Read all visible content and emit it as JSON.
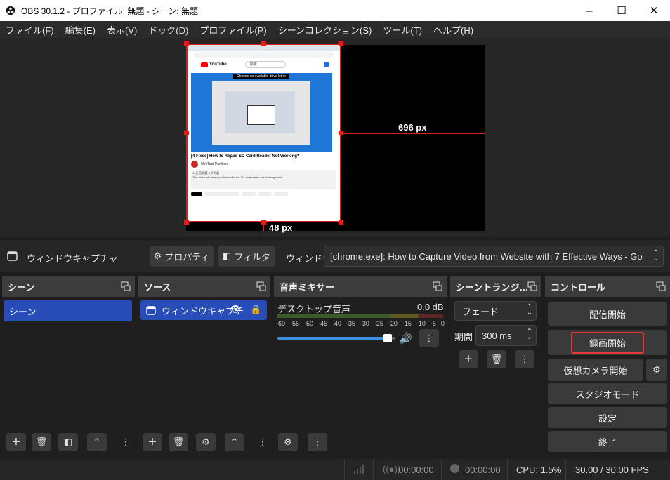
{
  "window": {
    "title": "OBS 30.1.2 - プロファイル: 無題 - シーン: 無題",
    "minimize": "─",
    "maximize": "☐",
    "close": "✕"
  },
  "menu": [
    "ファイル(F)",
    "編集(E)",
    "表示(V)",
    "ドック(D)",
    "プロファイル(P)",
    "シーンコレクション(S)",
    "ツール(T)",
    "ヘルプ(H)"
  ],
  "preview": {
    "width_label": "696 px",
    "height_label": "48 px",
    "thumb": {
      "logo": "YouTube",
      "search": "検索",
      "dialog_title": "Choose an available drive letter",
      "video_title": "[4 Fixes] How to Repair SD Card Reader Not Working?",
      "channel": "MiniTool Partition",
      "desc_line1": "14万 回視聴 4 か月前",
      "desc_line2": "This video will show you how to fix the SD card reader not working issue."
    }
  },
  "source_toolbar": {
    "source_name": "ウィンドウキャプチャ",
    "properties_label": "プロパティ",
    "filters_label": "フィルタ",
    "window_label": "ウィンドウ",
    "window_value": "[chrome.exe]: How to Capture Video from Website with 7 Effective Ways - Go"
  },
  "docks": {
    "scenes": {
      "title": "シーン",
      "items": [
        "シーン"
      ]
    },
    "sources": {
      "title": "ソース",
      "items": [
        "ウィンドウキャプチ"
      ]
    },
    "mixer": {
      "title": "音声ミキサー",
      "channel_name": "デスクトップ音声",
      "level": "0.0 dB",
      "scale": [
        "-60",
        "-55",
        "-50",
        "-45",
        "-40",
        "-35",
        "-30",
        "-25",
        "-20",
        "-15",
        "-10",
        "-5",
        "0"
      ],
      "volume_fraction": 0.97
    },
    "transitions": {
      "title": "シーントランジ…",
      "type": "フェード",
      "duration_label": "期間",
      "duration_value": "300 ms"
    },
    "controls": {
      "title": "コントロール",
      "start_streaming": "配信開始",
      "start_recording": "録画開始",
      "start_virtualcam": "仮想カメラ開始",
      "studio_mode": "スタジオモード",
      "settings": "設定",
      "exit": "終了"
    }
  },
  "status": {
    "stream_time": "00:00:00",
    "record_time": "00:00:00",
    "cpu": "CPU: 1.5%",
    "fps": "30.00 / 30.00 FPS"
  },
  "colors": {
    "accent_blue": "#284cb8",
    "selection_red": "#e01c1c",
    "highlight_red": "#e53935"
  }
}
